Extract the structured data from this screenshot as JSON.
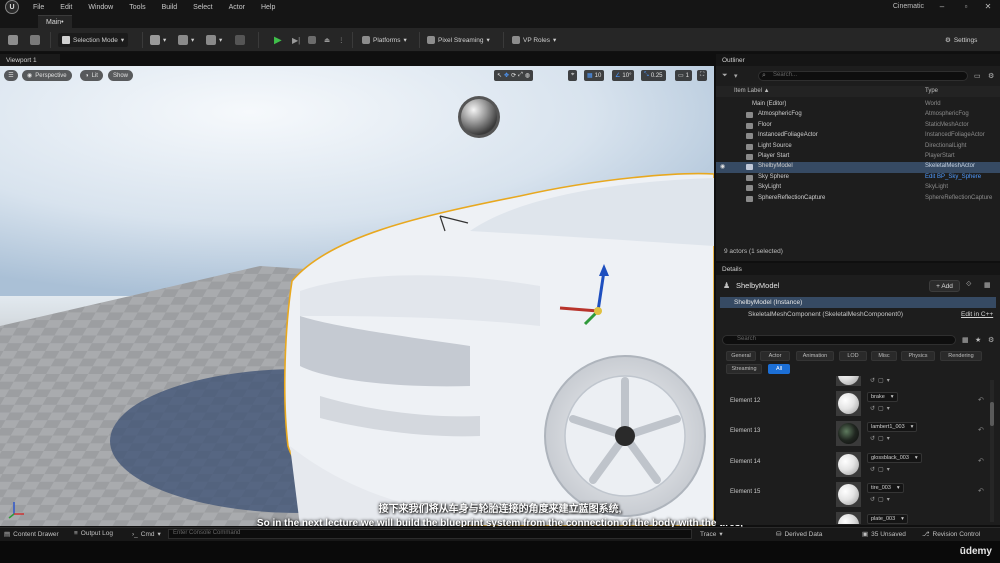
{
  "menubar": {
    "items": [
      "File",
      "Edit",
      "Window",
      "Tools",
      "Build",
      "Select",
      "Actor",
      "Help"
    ],
    "project": "Cinematic"
  },
  "tabs": {
    "main": "Main•"
  },
  "toolbar": {
    "mode": "Selection Mode",
    "platforms": "Platforms",
    "pixel_streaming": "Pixel Streaming",
    "vp_roles": "VP Roles",
    "settings": "Settings"
  },
  "viewport": {
    "tab": "Viewport 1",
    "perspective": "Perspective",
    "lit": "Lit",
    "show": "Show",
    "grid_snap": "10",
    "rot_snap": "10°",
    "scale_snap": "0.25",
    "cam_speed": "1"
  },
  "subtitles": {
    "chinese": "接下来我们将从车身与轮胎连接的角度来建立蓝图系统,",
    "english": "So in the next lecture we will build the blueprint system from the connection of the body with the tires,"
  },
  "statusbar": {
    "content_drawer": "Content Drawer",
    "output_log": "Output Log",
    "cmd": "Cmd",
    "console_placeholder": "Enter Console Command",
    "trace": "Trace",
    "derived_data": "Derived Data",
    "unsaved": "35 Unsaved",
    "revision_control": "Revision Control"
  },
  "outliner": {
    "title": "Outliner",
    "search_placeholder": "Search...",
    "col_label": "Item Label ▲",
    "col_type": "Type",
    "rows": [
      {
        "label": "Main (Editor)",
        "type": "World"
      },
      {
        "label": "AtmosphericFog",
        "type": "AtmosphericFog"
      },
      {
        "label": "Floor",
        "type": "StaticMeshActor"
      },
      {
        "label": "InstancedFoliageActor",
        "type": "InstancedFoliageActor"
      },
      {
        "label": "Light Source",
        "type": "DirectionalLight"
      },
      {
        "label": "Player Start",
        "type": "PlayerStart"
      },
      {
        "label": "ShelbyModel",
        "type": "SkeletalMeshActor"
      },
      {
        "label": "Sky Sphere",
        "type": "Edit BP_Sky_Sphere"
      },
      {
        "label": "SkyLight",
        "type": "SkyLight"
      },
      {
        "label": "SphereReflectionCapture",
        "type": "SphereReflectionCapture"
      }
    ],
    "count": "9 actors (1 selected)"
  },
  "details": {
    "tab": "Details",
    "title": "ShelbyModel",
    "add": "+ Add",
    "instance": "ShelbyModel (Instance)",
    "component": "SkeletalMeshComponent (SkeletalMeshComponent0)",
    "edit_cpp": "Edit in C++",
    "search_placeholder": "Search",
    "filters": [
      "General",
      "Actor",
      "Animation",
      "LOD",
      "Misc",
      "Physics",
      "Rendering",
      "Streaming",
      "All"
    ],
    "elements": [
      {
        "label": "Element 12",
        "material": "brake"
      },
      {
        "label": "Element 13",
        "material": "lambert1_003"
      },
      {
        "label": "Element 14",
        "material": "glossblack_003"
      },
      {
        "label": "Element 15",
        "material": "tire_003"
      }
    ],
    "last_material": "plate_003"
  },
  "branding": "ūdemy"
}
